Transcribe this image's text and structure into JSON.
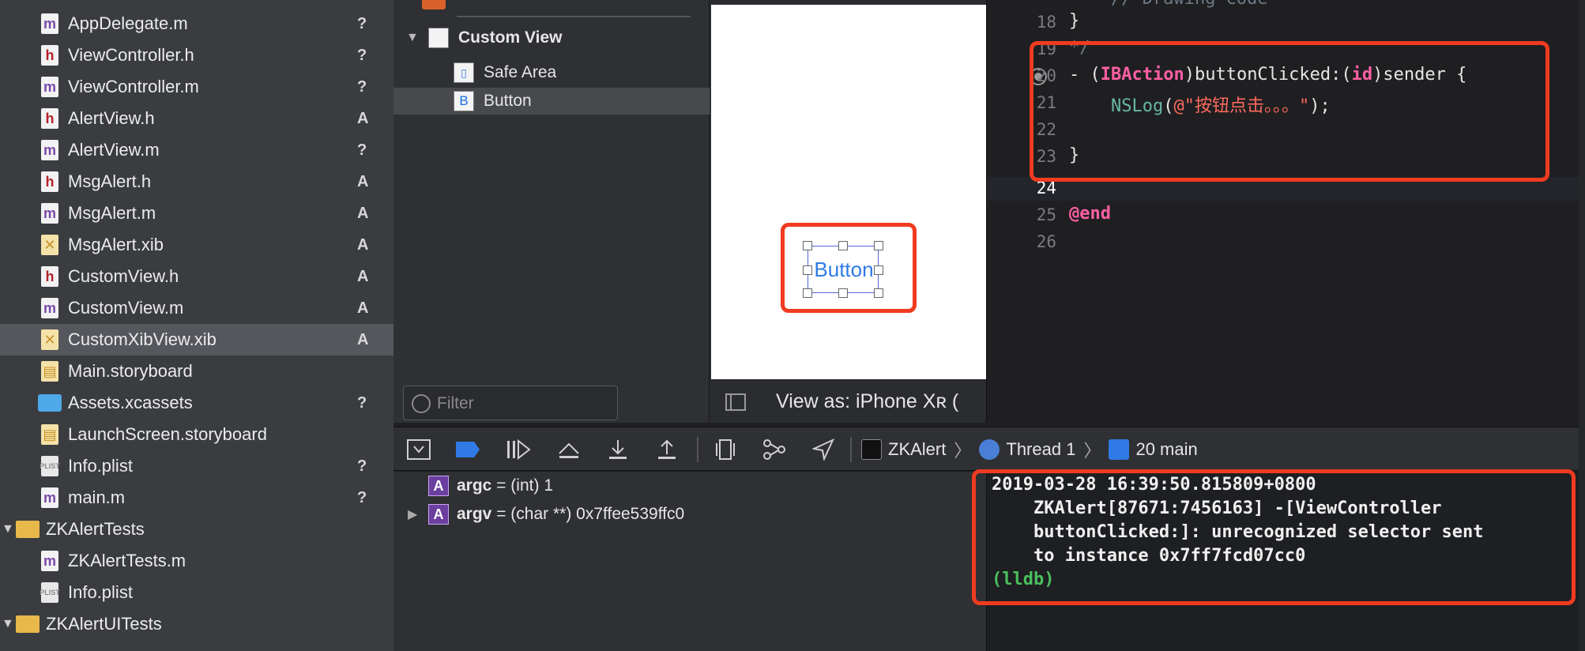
{
  "navigator": {
    "items": [
      {
        "label": "AppDelegate.m",
        "icon": "m-file-icon",
        "status": "?"
      },
      {
        "label": "ViewController.h",
        "icon": "h-file-icon",
        "status": "?"
      },
      {
        "label": "ViewController.m",
        "icon": "m-file-icon",
        "status": "?"
      },
      {
        "label": "AlertView.h",
        "icon": "h-file-icon",
        "status": "A"
      },
      {
        "label": "AlertView.m",
        "icon": "m-file-icon",
        "status": "?"
      },
      {
        "label": "MsgAlert.h",
        "icon": "h-file-icon",
        "status": "A"
      },
      {
        "label": "MsgAlert.m",
        "icon": "m-file-icon",
        "status": "A"
      },
      {
        "label": "MsgAlert.xib",
        "icon": "xib-file-icon",
        "status": "A"
      },
      {
        "label": "CustomView.h",
        "icon": "h-file-icon",
        "status": "A"
      },
      {
        "label": "CustomView.m",
        "icon": "m-file-icon",
        "status": "A"
      },
      {
        "label": "CustomXibView.xib",
        "icon": "xib-file-icon",
        "status": "A"
      },
      {
        "label": "Main.storyboard",
        "icon": "storyboard-file-icon",
        "status": ""
      },
      {
        "label": "Assets.xcassets",
        "icon": "assets-folder-icon",
        "status": "?"
      },
      {
        "label": "LaunchScreen.storyboard",
        "icon": "storyboard-file-icon",
        "status": ""
      },
      {
        "label": "Info.plist",
        "icon": "plist-file-icon",
        "status": "?"
      },
      {
        "label": "main.m",
        "icon": "m-file-icon",
        "status": "?"
      },
      {
        "label": "ZKAlertTests",
        "icon": "folder-icon",
        "status": ""
      },
      {
        "label": "ZKAlertTests.m",
        "icon": "m-file-icon",
        "status": ""
      },
      {
        "label": "Info.plist",
        "icon": "plist-file-icon",
        "status": ""
      },
      {
        "label": "ZKAlertUITests",
        "icon": "folder-icon",
        "status": ""
      }
    ]
  },
  "outline": {
    "items": [
      {
        "label": "Custom View"
      },
      {
        "label": "Safe Area"
      },
      {
        "label": "Button"
      }
    ],
    "filter_placeholder": "Filter"
  },
  "canvas": {
    "button_label": "Button",
    "view_as": "View as: iPhone Xʀ ("
  },
  "editor": {
    "lines": [
      {
        "number": "18",
        "text": "}"
      },
      {
        "number": "19",
        "text": "*/"
      },
      {
        "number": "20",
        "text": "- (IBAction)buttonClicked:(id)sender {"
      },
      {
        "number": "21",
        "text": "    NSLog(@\"按钮点击。。。\");"
      },
      {
        "number": "22",
        "text": ""
      },
      {
        "number": "23",
        "text": "}"
      },
      {
        "number": "24",
        "text": ""
      },
      {
        "number": "25",
        "text": "@end"
      },
      {
        "number": "26",
        "text": ""
      }
    ],
    "code_tokens": {
      "dash": "- (",
      "ibaction": "IBAction",
      "method": ")buttonClicked:(",
      "id": "id",
      "sender": ")sender {",
      "nslog": "NSLog",
      "paren": "(",
      "string": "@\"按钮点击。。。\"",
      "close": ");",
      "end": "@end"
    }
  },
  "debugbar": {
    "breadcrumb": {
      "target": "ZKAlert",
      "thread": "Thread 1",
      "frame": "20 main"
    }
  },
  "variables": [
    {
      "name": "argc",
      "type": "(int)",
      "value": "1"
    },
    {
      "name": "argv",
      "type": "(char **)",
      "value": "0x7ffee539ffc0"
    }
  ],
  "console": {
    "lines": [
      "2019-03-28 16:39:50.815809+0800",
      "    ZKAlert[87671:7456163] -[ViewController",
      "    buttonClicked:]: unrecognized selector sent",
      "    to instance 0x7ff7fcd07cc0"
    ],
    "prompt": "(lldb)"
  },
  "colors": {
    "annotation_red": "#f03b20",
    "keyword": "#fc5fa3",
    "string": "#fc6a5d",
    "function": "#67b7a4",
    "lldb_prompt": "#4bbf5e"
  }
}
